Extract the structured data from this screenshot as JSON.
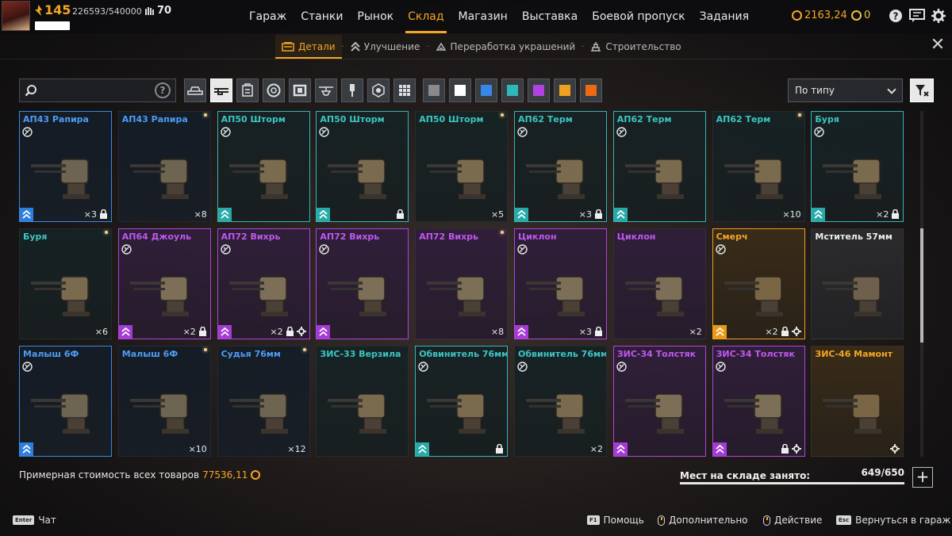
{
  "header": {
    "level": "145",
    "xp": "226593/540000",
    "reputation": "70",
    "nav": [
      "Гараж",
      "Станки",
      "Рынок",
      "Склад",
      "Магазин",
      "Выставка",
      "Боевой пропуск",
      "Задания"
    ],
    "active_nav": "Склад",
    "currency_coins": "2163,24",
    "currency_gold": "0"
  },
  "subnav": {
    "tabs": [
      "Детали",
      "Улучшение",
      "Переработка украшений",
      "Строительство"
    ],
    "active": "Детали"
  },
  "filters": {
    "search_placeholder": "",
    "sort_label": "По типу",
    "category_icons": [
      "cabin-icon",
      "weapon-icon",
      "module-icon",
      "wheel-icon",
      "frame-icon",
      "drone-icon",
      "paint-icon",
      "engine-icon",
      "grid-icon"
    ],
    "rarity_swatches": [
      "#8a8a8a",
      "#ffffff",
      "#3a86e8",
      "#2fb8b8",
      "#b043e0",
      "#f0a020",
      "#ee6a12"
    ]
  },
  "items": [
    {
      "name": "АП43 Рапира",
      "rarity": "blue",
      "framed": true,
      "star": false,
      "exchange": true,
      "tier_badge": true,
      "count": "×3",
      "locked": true,
      "gear": false
    },
    {
      "name": "АП43 Рапира",
      "rarity": "blue",
      "framed": false,
      "star": true,
      "exchange": false,
      "tier_badge": false,
      "count": "×8",
      "locked": false,
      "gear": false
    },
    {
      "name": "АП50 Шторм",
      "rarity": "teal",
      "framed": true,
      "star": false,
      "exchange": true,
      "tier_badge": true,
      "count": "",
      "locked": false,
      "gear": false
    },
    {
      "name": "АП50 Шторм",
      "rarity": "teal",
      "framed": true,
      "star": false,
      "exchange": true,
      "tier_badge": true,
      "count": "",
      "locked": true,
      "gear": false
    },
    {
      "name": "АП50 Шторм",
      "rarity": "teal",
      "framed": false,
      "star": true,
      "exchange": false,
      "tier_badge": false,
      "count": "×5",
      "locked": false,
      "gear": false
    },
    {
      "name": "АП62 Терм",
      "rarity": "teal",
      "framed": true,
      "star": false,
      "exchange": true,
      "tier_badge": true,
      "count": "×3",
      "locked": true,
      "gear": false
    },
    {
      "name": "АП62 Терм",
      "rarity": "teal",
      "framed": true,
      "star": false,
      "exchange": true,
      "tier_badge": true,
      "count": "",
      "locked": false,
      "gear": false
    },
    {
      "name": "АП62 Терм",
      "rarity": "teal",
      "framed": false,
      "star": true,
      "exchange": false,
      "tier_badge": false,
      "count": "×10",
      "locked": false,
      "gear": false
    },
    {
      "name": "Буря",
      "rarity": "teal",
      "framed": true,
      "star": false,
      "exchange": true,
      "tier_badge": true,
      "count": "×2",
      "locked": true,
      "gear": false
    },
    {
      "name": "Буря",
      "rarity": "teal",
      "framed": false,
      "star": true,
      "exchange": false,
      "tier_badge": false,
      "count": "×6",
      "locked": false,
      "gear": false
    },
    {
      "name": "АП64 Джоуль",
      "rarity": "purple",
      "framed": true,
      "star": false,
      "exchange": true,
      "tier_badge": true,
      "count": "×2",
      "locked": true,
      "gear": false
    },
    {
      "name": "АП72 Вихрь",
      "rarity": "purple",
      "framed": true,
      "star": false,
      "exchange": true,
      "tier_badge": true,
      "count": "×2",
      "locked": true,
      "gear": true
    },
    {
      "name": "АП72 Вихрь",
      "rarity": "purple",
      "framed": true,
      "star": false,
      "exchange": true,
      "tier_badge": true,
      "count": "",
      "locked": false,
      "gear": false
    },
    {
      "name": "АП72 Вихрь",
      "rarity": "purple",
      "framed": false,
      "star": true,
      "exchange": false,
      "tier_badge": false,
      "count": "×8",
      "locked": false,
      "gear": false
    },
    {
      "name": "Циклон",
      "rarity": "purple",
      "framed": true,
      "star": false,
      "exchange": true,
      "tier_badge": true,
      "count": "×3",
      "locked": true,
      "gear": false
    },
    {
      "name": "Циклон",
      "rarity": "purple",
      "framed": false,
      "star": false,
      "exchange": false,
      "tier_badge": false,
      "count": "×2",
      "locked": false,
      "gear": false
    },
    {
      "name": "Смерч",
      "rarity": "orange",
      "framed": true,
      "star": false,
      "exchange": true,
      "tier_badge": true,
      "count": "×2",
      "locked": true,
      "gear": true
    },
    {
      "name": "Мститель 57мм",
      "rarity": "white",
      "framed": false,
      "star": false,
      "exchange": false,
      "tier_badge": false,
      "count": "",
      "locked": false,
      "gear": false
    },
    {
      "name": "Малыш 6Ф",
      "rarity": "blue",
      "framed": true,
      "star": false,
      "exchange": true,
      "tier_badge": true,
      "count": "",
      "locked": false,
      "gear": false
    },
    {
      "name": "Малыш 6Ф",
      "rarity": "blue",
      "framed": false,
      "star": true,
      "exchange": false,
      "tier_badge": false,
      "count": "×10",
      "locked": false,
      "gear": false
    },
    {
      "name": "Судья 76мм",
      "rarity": "blue",
      "framed": false,
      "star": true,
      "exchange": false,
      "tier_badge": false,
      "count": "×12",
      "locked": false,
      "gear": false
    },
    {
      "name": "ЗИС-33 Верзила",
      "rarity": "teal",
      "framed": false,
      "star": false,
      "exchange": false,
      "tier_badge": false,
      "count": "",
      "locked": false,
      "gear": false
    },
    {
      "name": "Обвинитель 76мм",
      "rarity": "teal",
      "framed": true,
      "star": false,
      "exchange": true,
      "tier_badge": true,
      "count": "",
      "locked": true,
      "gear": false
    },
    {
      "name": "Обвинитель 76мм",
      "rarity": "teal",
      "framed": false,
      "star": false,
      "exchange": true,
      "tier_badge": false,
      "count": "×2",
      "locked": false,
      "gear": false
    },
    {
      "name": "ЗИС-34 Толстяк",
      "rarity": "purple",
      "framed": true,
      "star": false,
      "exchange": true,
      "tier_badge": true,
      "count": "",
      "locked": false,
      "gear": false
    },
    {
      "name": "ЗИС-34 Толстяк",
      "rarity": "purple",
      "framed": true,
      "star": false,
      "exchange": true,
      "tier_badge": true,
      "count": "",
      "locked": true,
      "gear": true
    },
    {
      "name": "ЗИС-46 Мамонт",
      "rarity": "orange",
      "framed": false,
      "star": false,
      "exchange": false,
      "tier_badge": false,
      "count": "",
      "locked": false,
      "gear": true
    }
  ],
  "summary": {
    "total_label": "Примерная стоимость всех товаров",
    "total_value": "77536,11",
    "storage_label": "Мест на складе занято:",
    "storage_value": "649/650",
    "storage_fill": 0.9985
  },
  "footer": [
    {
      "key": "Enter",
      "label": "Чат"
    },
    {
      "key": "F1",
      "label": "Помощь"
    },
    {
      "key": "mouse",
      "label": "Дополнительно"
    },
    {
      "key": "mouse",
      "label": "Действие"
    },
    {
      "key": "Esc",
      "label": "Вернуться в гараж"
    }
  ]
}
